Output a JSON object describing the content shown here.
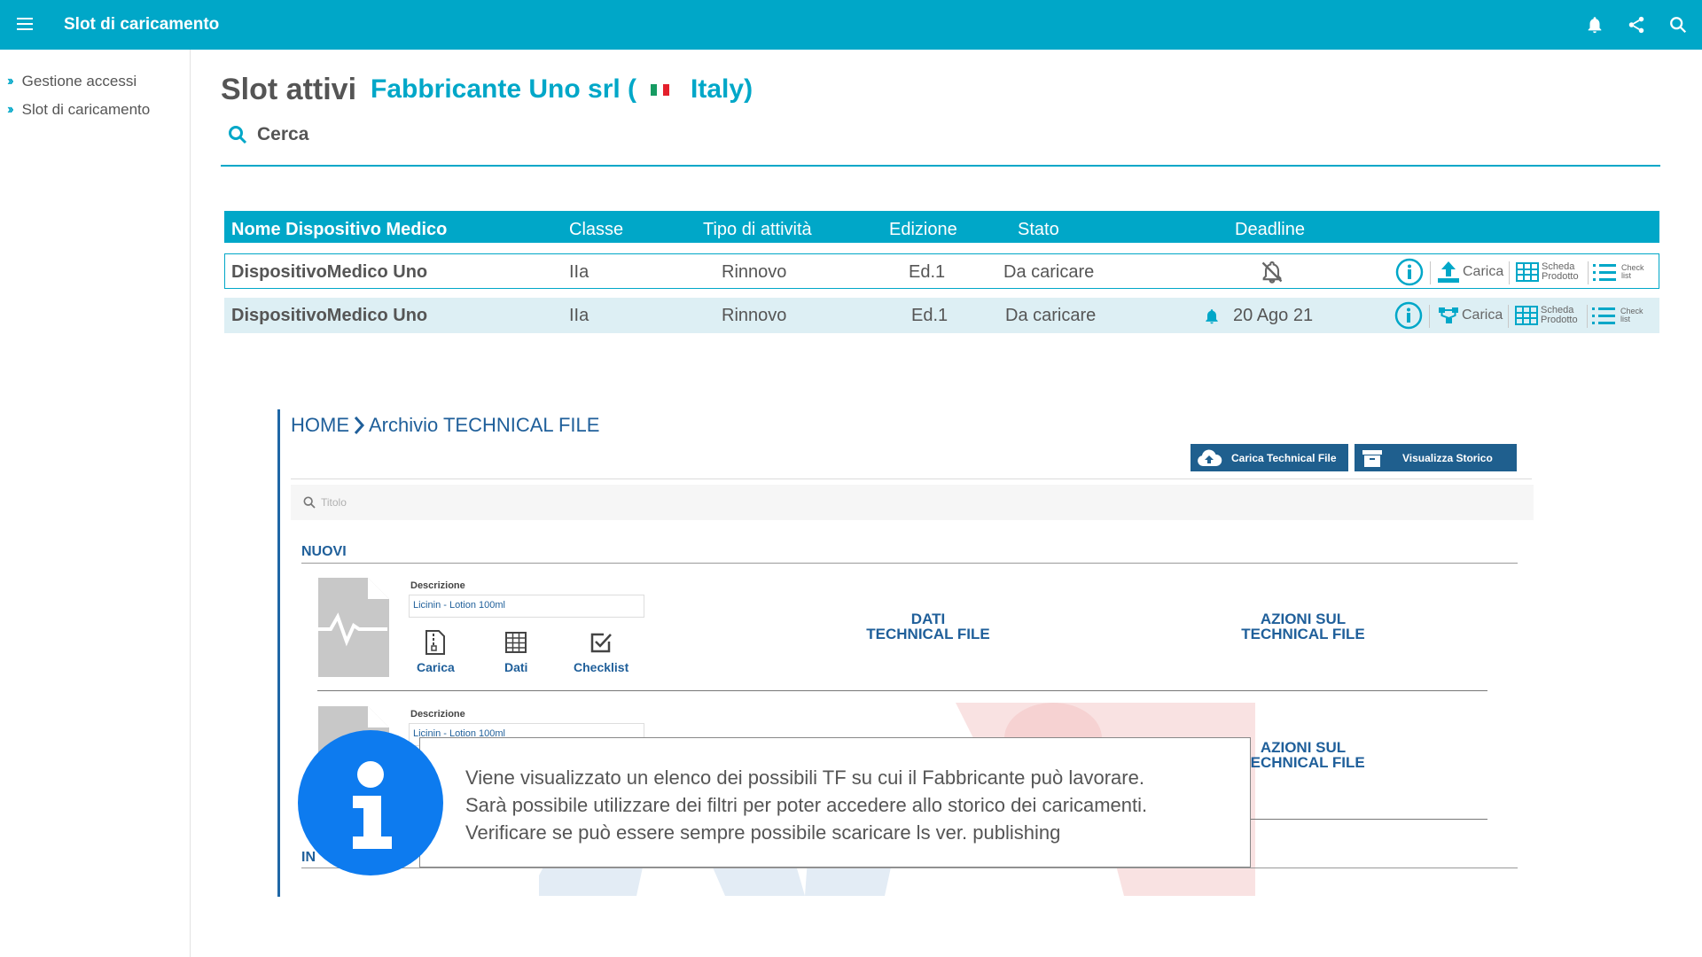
{
  "header": {
    "title": "Slot di caricamento",
    "icons": [
      "menu-icon",
      "bell-icon",
      "share-icon",
      "search-icon"
    ]
  },
  "sidebar": {
    "items": [
      {
        "label": "Gestione accessi"
      },
      {
        "label": "Slot di caricamento"
      }
    ]
  },
  "main": {
    "title": "Slot attivi",
    "company_name": "Fabbricante Uno srl (",
    "company_country": "Italy)",
    "search_label": "Cerca"
  },
  "table": {
    "columns": [
      "Nome Dispositivo Medico",
      "Classe",
      "Tipo di attività",
      "Edizione",
      "Stato",
      "Deadline"
    ],
    "rows": [
      {
        "name": "DispositivoMedico Uno",
        "classe": "IIa",
        "tipo": "Rinnovo",
        "edizione": "Ed.1",
        "stato": "Da caricare",
        "deadline": "",
        "deadline_icon": "bell-off-icon"
      },
      {
        "name": "DispositivoMedico Uno",
        "classe": "IIa",
        "tipo": "Rinnovo",
        "edizione": "Ed.1",
        "stato": "Da caricare",
        "deadline": "20 Ago 21",
        "deadline_icon": "bell-icon"
      }
    ],
    "actions": {
      "carica": "Carica",
      "scheda_line1": "Scheda",
      "scheda_line2": "Prodotto",
      "check_line1": "Check",
      "check_line2": "list"
    }
  },
  "technical_file": {
    "breadcrumb_home": "HOME",
    "breadcrumb_current": "Archivio TECHNICAL FILE",
    "upload_button": "Carica Technical File",
    "history_button": "Visualizza Storico",
    "filter_placeholder": "Titolo",
    "section_new": "NUOVI",
    "section_in": "IN",
    "items": [
      {
        "desc_label": "Descrizione",
        "desc_value": "Licinin - Lotion 100ml"
      },
      {
        "desc_label": "Descrizione",
        "desc_value": "Licinin - Lotion 100ml"
      }
    ],
    "item_actions": {
      "carica": "Carica",
      "dati": "Dati",
      "checklist": "Checklist"
    },
    "col_dati_line1": "DATI",
    "col_dati_line2": "TECHNICAL FILE",
    "col_azioni_line1": "AZIONI SUL",
    "col_azioni_line2": "TECHNICAL FILE"
  },
  "info_callout": {
    "line1": "Viene visualizzato un elenco dei possibili TF su cui il Fabbricante può lavorare.",
    "line2": "Sarà possibile utilizzare dei filtri per poter accedere allo storico dei caricamenti.",
    "line3": "Verificare se può essere sempre possibile scaricare ls ver. publishing",
    "icon": "info-icon"
  },
  "colors": {
    "accent": "#00A7C8",
    "dark_blue": "#1F5F9A",
    "info_blue": "#0D7BEF",
    "row_highlight": "#DDEFF4"
  }
}
